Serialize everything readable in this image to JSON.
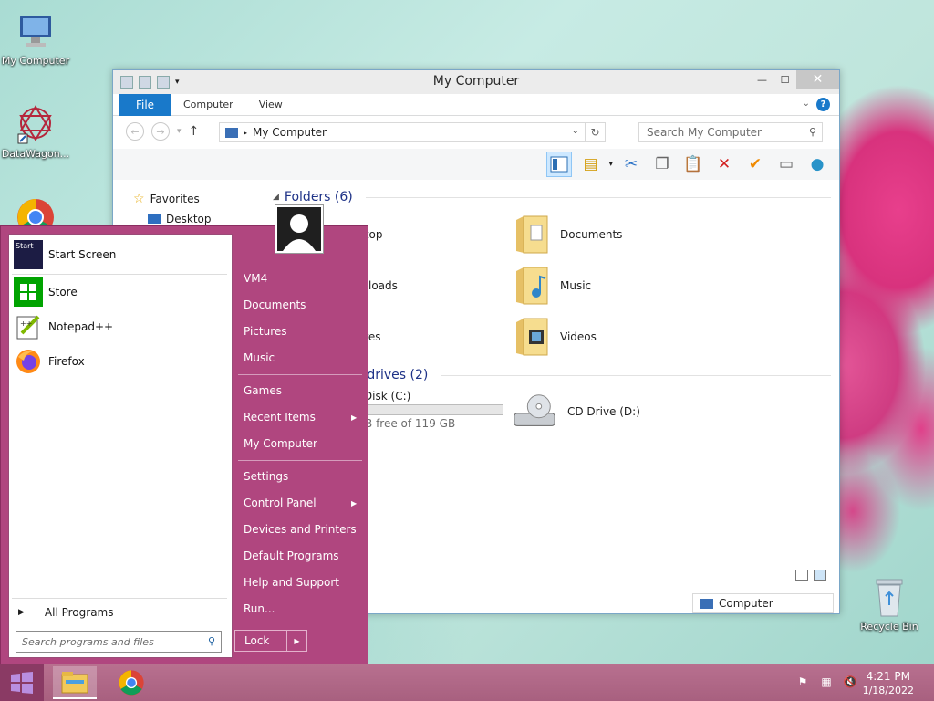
{
  "desktop": {
    "icons": [
      {
        "label": "My Computer",
        "icon": "computer-icon"
      },
      {
        "label": "DataWagon...",
        "icon": "datawagon-icon"
      },
      {
        "label": "Recycle Bin",
        "icon": "recycle-bin-icon"
      }
    ]
  },
  "window": {
    "title": "My Computer",
    "ribbon_tabs": {
      "file": "File",
      "computer": "Computer",
      "view": "View"
    },
    "address": "My Computer",
    "search_placeholder": "Search My Computer",
    "navpane": {
      "favorites": "Favorites",
      "desktop": "Desktop"
    },
    "folders_header": "Folders (6)",
    "folders": [
      {
        "label": "Desktop",
        "icon": "folder-desktop-icon"
      },
      {
        "label": "Downloads",
        "icon": "folder-downloads-icon"
      },
      {
        "label": "Pictures",
        "icon": "folder-pictures-icon"
      },
      {
        "label": "Documents",
        "icon": "folder-documents-icon"
      },
      {
        "label": "Music",
        "icon": "folder-music-icon"
      },
      {
        "label": "Videos",
        "icon": "folder-videos-icon"
      }
    ],
    "drives_header": "Devices and drives (2)",
    "drives": [
      {
        "label": "Local Disk (C:)",
        "free": "100 GB free of 119 GB",
        "used_fraction": 0.16,
        "icon": "hard-drive-icon"
      },
      {
        "label": "CD Drive (D:)",
        "icon": "cd-drive-icon"
      }
    ],
    "status": "Computer"
  },
  "start_menu": {
    "pinned": [
      {
        "label": "Start Screen",
        "icon": "start-screen-icon"
      },
      {
        "label": "Store",
        "icon": "store-icon"
      },
      {
        "label": "Notepad++",
        "icon": "notepadpp-icon"
      },
      {
        "label": "Firefox",
        "icon": "firefox-icon"
      }
    ],
    "all_programs": "All Programs",
    "search_placeholder": "Search programs and files",
    "right_links": {
      "user": "VM4",
      "documents": "Documents",
      "pictures": "Pictures",
      "music": "Music",
      "games": "Games",
      "recent": "Recent Items",
      "computer": "My Computer",
      "settings": "Settings",
      "control_panel": "Control Panel",
      "devices": "Devices and Printers",
      "default_programs": "Default Programs",
      "help": "Help and Support",
      "run": "Run..."
    },
    "lock": "Lock"
  },
  "taskbar": {
    "time": "4:21 PM",
    "date": "1/18/2022",
    "accent": "#b0467f"
  }
}
